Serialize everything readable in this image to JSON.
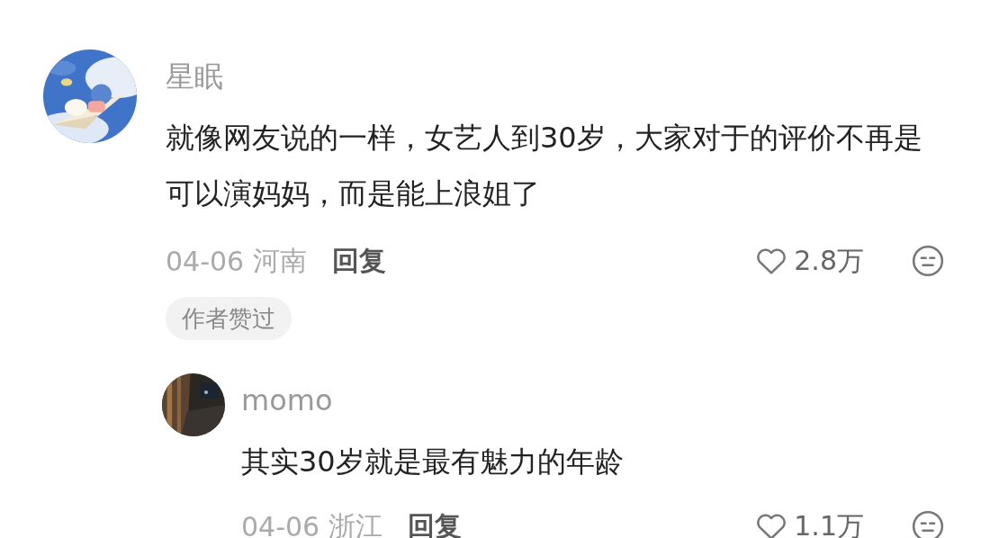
{
  "comments": [
    {
      "user": "星眠",
      "text": "就像网友说的一样，女艺人到30岁，大家对于的评价不再是可以演妈妈，而是能上浪姐了",
      "date": "04-06",
      "location": "河南",
      "reply_label": "回复",
      "likes": "2.8万",
      "badge": "作者赞过",
      "replies": [
        {
          "user": "momo",
          "text": "其实30岁就是最有魅力的年龄",
          "date": "04-06",
          "location": "浙江",
          "reply_label": "回复",
          "likes": "1.1万"
        }
      ]
    }
  ]
}
